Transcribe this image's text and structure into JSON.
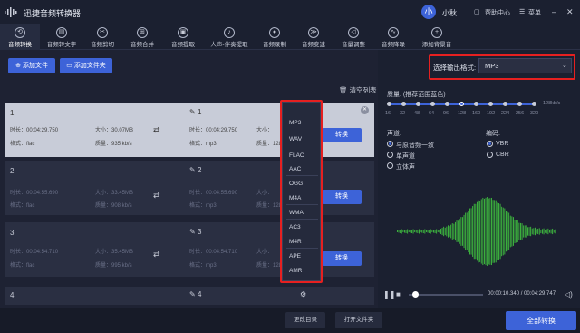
{
  "app": {
    "title": "迅捷音频转换器",
    "avatar": "小",
    "user": "小秋",
    "help": "帮助中心",
    "menu": "菜单"
  },
  "toolbar": [
    "音频转换",
    "音频转文字",
    "音频剪切",
    "音频合并",
    "音频提取",
    "人声-伴奏提取",
    "音频录制",
    "音频变速",
    "音量调整",
    "音频降噪",
    "添加背景音"
  ],
  "actions": {
    "add_file": "添加文件",
    "add_folder": "添加文件夹",
    "clear": "清空列表",
    "convert": "转换",
    "change_dir": "更改目录",
    "open_folder": "打开文件夹",
    "convert_all": "全部转换"
  },
  "files": [
    {
      "num": "1",
      "out_num": "1",
      "dur_in": "时长：00:04:29.750",
      "size_in": "大小：30.07MB",
      "fmt_in": "格式：flac",
      "q_in": "质量：935 kb/s",
      "dur_out": "时长：00:04:29.750",
      "size_out": "大小：",
      "fmt_out": "格式：mp3",
      "q_out": "质量：128k"
    },
    {
      "num": "2",
      "out_num": "2",
      "dur_in": "时长：00:04:55.690",
      "size_in": "大小：33.45MB",
      "fmt_in": "格式：flac",
      "q_in": "质量：908 kb/s",
      "dur_out": "时长：00:04:55.690",
      "size_out": "大小：",
      "fmt_out": "格式：mp3",
      "q_out": "质量：128k"
    },
    {
      "num": "3",
      "out_num": "3",
      "dur_in": "时长：00:04:54.710",
      "size_in": "大小：35.45MB",
      "fmt_in": "格式：flac",
      "q_in": "质量：995 kb/s",
      "dur_out": "时长：00:04:54.710",
      "size_out": "大小：",
      "fmt_out": "格式：mp3",
      "q_out": "质量：128k"
    },
    {
      "num": "4",
      "out_num": "4"
    }
  ],
  "formats": [
    "MP3",
    "WAV",
    "FLAC",
    "AAC",
    "OGG",
    "M4A",
    "WMA",
    "AC3",
    "M4R",
    "APE",
    "AMR"
  ],
  "settings": {
    "output_label": "选择输出格式:",
    "output_value": "MP3",
    "quality_label": "质量: (推荐范围蓝色)",
    "bitrates": [
      "16",
      "32",
      "48",
      "64",
      "96",
      "128",
      "160",
      "192",
      "224",
      "256",
      "320"
    ],
    "kbps": "128kb/s",
    "channel_label": "声道:",
    "channels": [
      "与原音频一致",
      "单声道",
      "立体声"
    ],
    "encoder_label": "编码:",
    "encoders": [
      "VBR",
      "CBR"
    ]
  },
  "player": {
    "time": "00:00:10.340 / 00:04:29.747"
  },
  "colors": {
    "accent": "#3d63d8",
    "highlight": "#e62020",
    "wave": "#3fbf3f"
  }
}
